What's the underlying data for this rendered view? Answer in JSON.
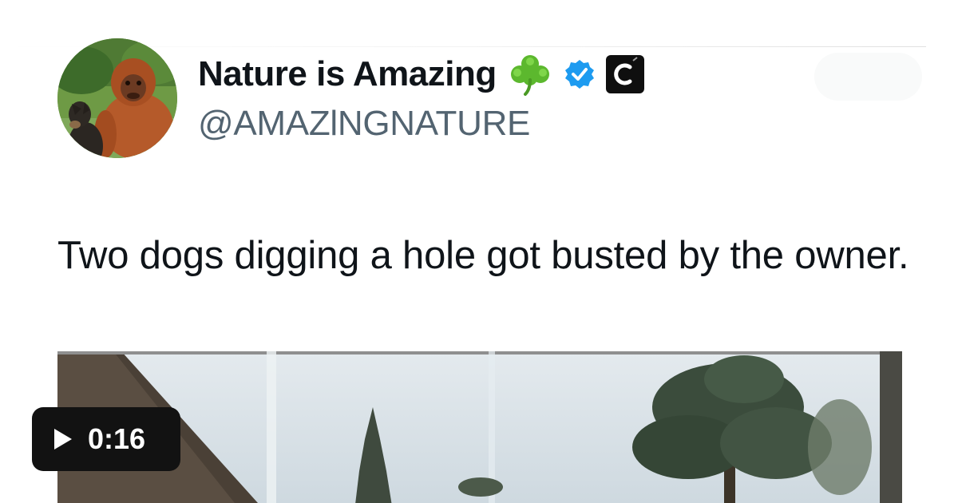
{
  "tweet": {
    "author": {
      "display_name": "Nature is Amazing",
      "handle": "@AMAZlNGNATURE",
      "badges": [
        "shamrock-icon",
        "verified-badge-icon",
        "c-logo-icon"
      ],
      "c_logo_letter": "C",
      "verified_color": "#1d9bf0"
    },
    "text": "Two dogs digging a hole got busted by the owner.",
    "media": {
      "type": "video",
      "duration": "0:16",
      "play_icon": "play-icon"
    }
  },
  "colors": {
    "text_primary": "#0f1419",
    "text_secondary": "#536471",
    "badge_bg": "#121212"
  }
}
